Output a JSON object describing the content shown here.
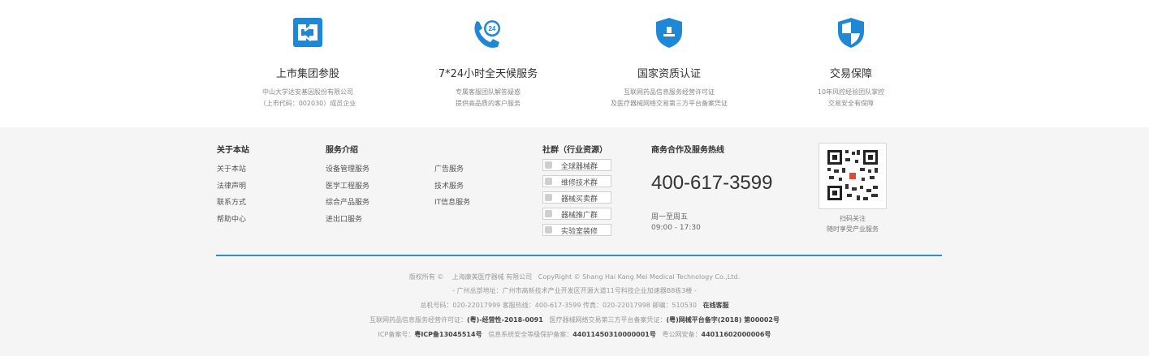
{
  "features": [
    {
      "icon": "listed-company-icon",
      "title": "上市集团参股",
      "desc1": "中山大学达安基因股份有限公司",
      "desc2": "（上市代码：002030）成员企业"
    },
    {
      "icon": "24h-phone-icon",
      "title": "7*24小时全天候服务",
      "desc1": "专属客服团队解答疑惑",
      "desc2": "提供高品质的客户服务"
    },
    {
      "icon": "certification-shield-icon",
      "title": "国家资质认证",
      "desc1": "互联网药品信息服务经营许可证",
      "desc2": "及医疗器械网络交易第三方平台备案凭证"
    },
    {
      "icon": "security-shield-icon",
      "title": "交易保障",
      "desc1": "10年风控经验团队掌控",
      "desc2": "交易安全有保障"
    }
  ],
  "footer": {
    "about": {
      "heading": "关于本站",
      "links": [
        "关于本站",
        "法律声明",
        "联系方式",
        "帮助中心"
      ]
    },
    "services": {
      "heading": "服务介绍",
      "col1": [
        "设备管理服务",
        "医学工程服务",
        "综合产品服务",
        "进出口服务"
      ],
      "col2": [
        "广告服务",
        "技术服务",
        "IT信息服务"
      ]
    },
    "community": {
      "heading": "社群（行业资源）",
      "groups": [
        "全球器械群",
        "维修技术群",
        "器械买卖群",
        "器械推广群",
        "实验室装修"
      ]
    },
    "hotline": {
      "heading": "商务合作及服务热线",
      "number": "400-617-3599",
      "days": "周一至周五",
      "hours": "09:00 - 17:30"
    },
    "qr": {
      "caption1": "扫码关注",
      "caption2": "随时享受产业服务"
    }
  },
  "copyright": {
    "line1_a": "版权所有 ©",
    "line1_b": "上海康美医疗器械 有限公司",
    "line1_c": "CopyRight © Shang Hai Kang Mei  Medical Technology Co.,Ltd.",
    "line2": "- 广州总部地址：广州市高新技术产业开发区开源大道11号科技企业加速器B8栋3楼 -",
    "line3_a": "总机号码：020-22017999  客服热线：400-617-3599  传真：020-22017998  邮编：510530",
    "line3_b": "在线客服",
    "line4_a": "互联网药品信息服务经营许可证：",
    "line4_b": "(粤)-经营性-2018-0091",
    "line4_c": "医疗器械网络交易第三方平台备案凭证：",
    "line4_d": "(粤)网械平台备字(2018) 第00002号",
    "line5_a": "ICP备案号：",
    "line5_b": "粤ICP备13045514号",
    "line5_c": "信息系统安全等级保护备案：",
    "line5_d": "44011450310000001号",
    "line5_e": "粤公网安备：",
    "line5_f": "44011602000006号"
  },
  "colors": {
    "accent": "#1e88d6",
    "divider": "#2b8ed6",
    "background": "#f5f5f5"
  }
}
